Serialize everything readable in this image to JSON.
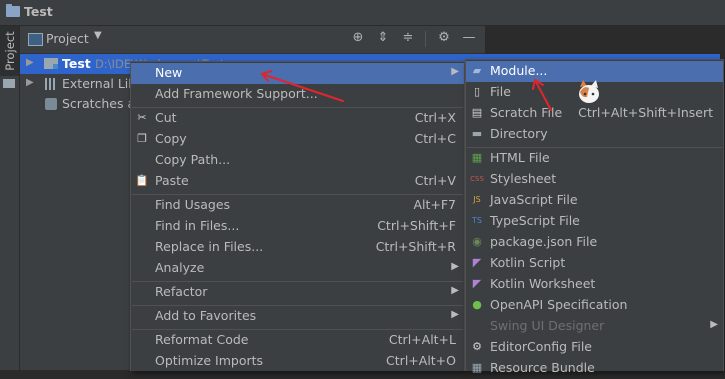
{
  "window": {
    "title": "Test"
  },
  "stripe": {
    "tab_label": "Project"
  },
  "project_toolbar": {
    "label": "Project",
    "dropdown_glyph": "▼"
  },
  "tree": {
    "root": {
      "name": "Test",
      "path": "D:\\IDE\\Workspace\\Test"
    },
    "external": {
      "label": "External Lib"
    },
    "scratches": {
      "label": "Scratches ar"
    }
  },
  "context_menu": {
    "items": [
      {
        "label": "New",
        "shortcut": "",
        "submenu": true
      },
      {
        "label": "Add Framework Support...",
        "shortcut": ""
      },
      {
        "label": "Cut",
        "shortcut": "Ctrl+X",
        "icon": "cut-icon"
      },
      {
        "label": "Copy",
        "shortcut": "Ctrl+C",
        "icon": "copy-icon"
      },
      {
        "label": "Copy Path...",
        "shortcut": ""
      },
      {
        "label": "Paste",
        "shortcut": "Ctrl+V",
        "icon": "paste-icon"
      },
      {
        "label": "Find Usages",
        "shortcut": "Alt+F7"
      },
      {
        "label": "Find in Files...",
        "shortcut": "Ctrl+Shift+F"
      },
      {
        "label": "Replace in Files...",
        "shortcut": "Ctrl+Shift+R"
      },
      {
        "label": "Analyze",
        "shortcut": "",
        "submenu": true
      },
      {
        "label": "Refactor",
        "shortcut": "",
        "submenu": true
      },
      {
        "label": "Add to Favorites",
        "shortcut": "",
        "submenu": true
      },
      {
        "label": "Reformat Code",
        "shortcut": "Ctrl+Alt+L"
      },
      {
        "label": "Optimize Imports",
        "shortcut": "Ctrl+Alt+O"
      }
    ]
  },
  "new_submenu": {
    "scratch_shortcut": "Ctrl+Alt+Shift+Insert",
    "items": [
      {
        "label": "Module...",
        "icon": "module-icon"
      },
      {
        "label": "File",
        "icon": "file-icon"
      },
      {
        "label": "Scratch File",
        "icon": "scratch-file-icon"
      },
      {
        "label": "Directory",
        "icon": "directory-icon"
      },
      {
        "label": "HTML File",
        "icon": "html-icon"
      },
      {
        "label": "Stylesheet",
        "icon": "css-icon"
      },
      {
        "label": "JavaScript File",
        "icon": "js-icon"
      },
      {
        "label": "TypeScript File",
        "icon": "ts-icon"
      },
      {
        "label": "package.json File",
        "icon": "npm-icon"
      },
      {
        "label": "Kotlin Script",
        "icon": "kotlin-icon"
      },
      {
        "label": "Kotlin Worksheet",
        "icon": "kotlin-worksheet-icon"
      },
      {
        "label": "OpenAPI Specification",
        "icon": "openapi-icon"
      },
      {
        "label": "Swing UI Designer",
        "icon": "",
        "disabled": true
      },
      {
        "label": "EditorConfig File",
        "icon": "editorconfig-icon"
      },
      {
        "label": "Resource Bundle",
        "icon": "resource-bundle-icon"
      }
    ]
  },
  "colors": {
    "selection": "#2f65ca",
    "menu_highlight": "#4b6eaf",
    "annotation_arrow": "#e0262b"
  }
}
